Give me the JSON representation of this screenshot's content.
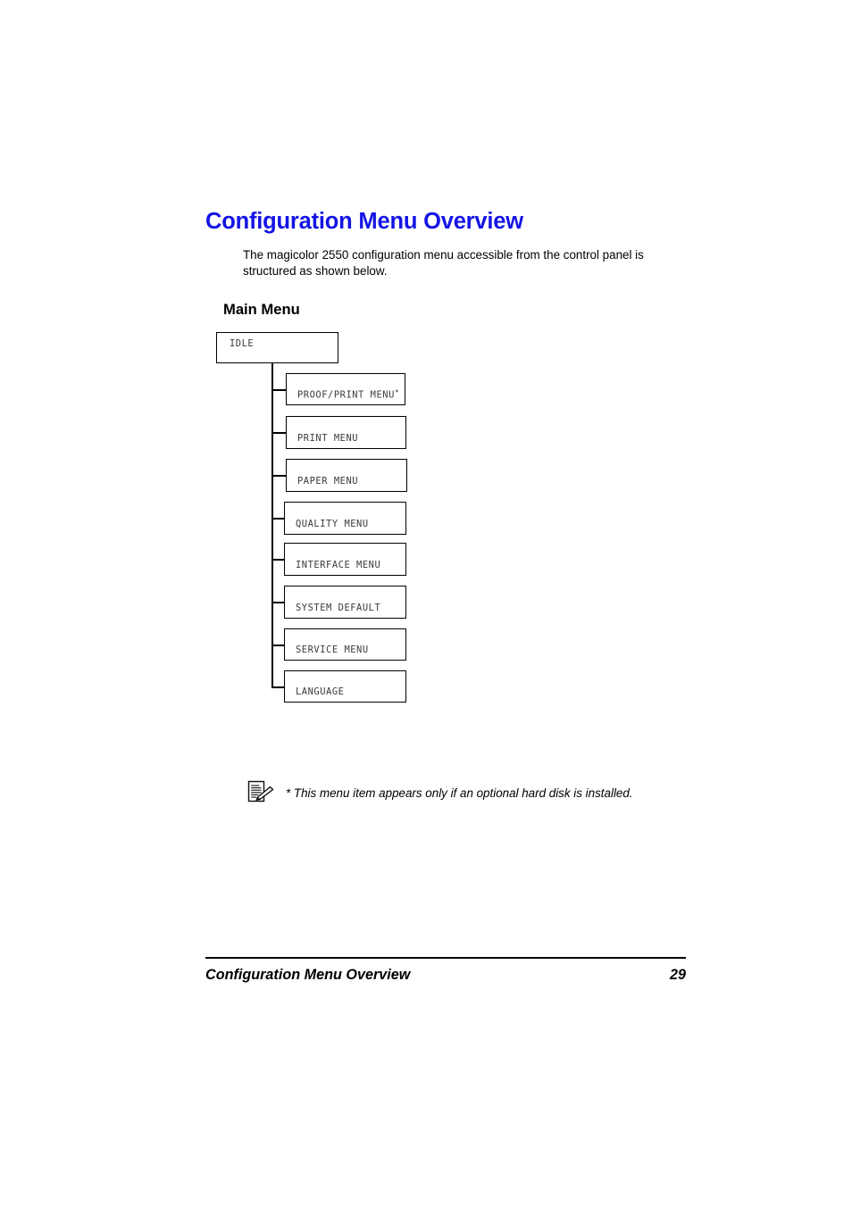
{
  "page": {
    "title": "Configuration Menu Overview",
    "intro": "The magicolor 2550 configuration menu accessible from the control panel is structured as shown below.",
    "subheading": "Main Menu"
  },
  "diagram": {
    "root": {
      "label": "IDLE"
    },
    "children": [
      {
        "label": "PROOF/PRINT MENU",
        "marker": "*"
      },
      {
        "label": "PRINT MENU",
        "marker": ""
      },
      {
        "label": "PAPER MENU",
        "marker": ""
      },
      {
        "label": "QUALITY MENU",
        "marker": ""
      },
      {
        "label": "INTERFACE MENU",
        "marker": ""
      },
      {
        "label": "SYSTEM DEFAULT",
        "marker": ""
      },
      {
        "label": "SERVICE MENU",
        "marker": ""
      },
      {
        "label": "LANGUAGE",
        "marker": ""
      }
    ]
  },
  "note": {
    "icon": "note-pencil-icon",
    "text": "* This menu item appears only if an optional hard disk is installed."
  },
  "footer": {
    "title": "Configuration Menu Overview",
    "page_number": "29"
  },
  "colors": {
    "heading": "#1414E6",
    "body": "#000000",
    "box_border": "#000000",
    "box_text": "#3A3A3A"
  }
}
